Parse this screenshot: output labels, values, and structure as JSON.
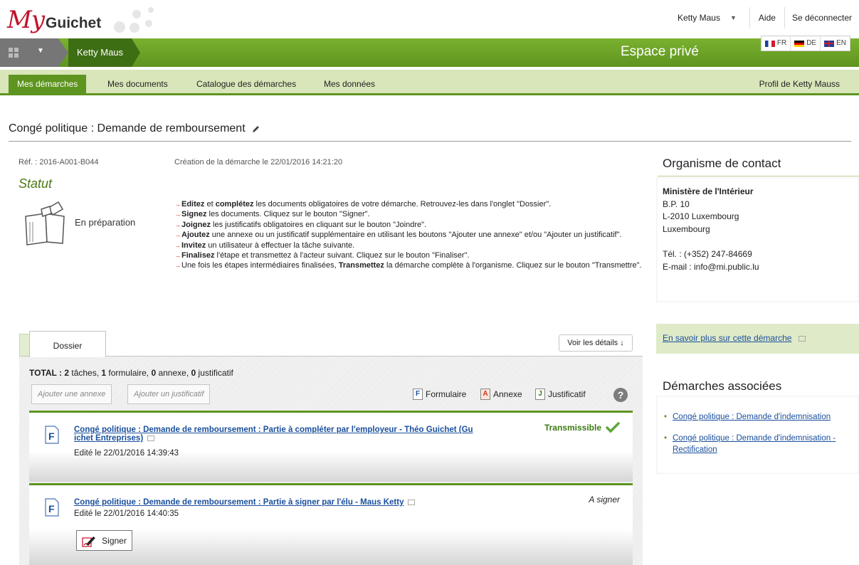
{
  "logo": {
    "my": "My",
    "guichet": "Guichet"
  },
  "user_menu": {
    "user_name": "Ketty Maus",
    "help": "Aide",
    "logout": "Se déconnecter"
  },
  "banner": {
    "user": "Ketty Maus",
    "title": "Espace privé"
  },
  "languages": [
    {
      "code": "FR",
      "flag": "fr"
    },
    {
      "code": "DE",
      "flag": "de"
    },
    {
      "code": "EN",
      "flag": "en"
    }
  ],
  "nav": {
    "items": [
      "Mes démarches",
      "Mes documents",
      "Catalogue des démarches",
      "Mes données"
    ],
    "active": "Mes démarches",
    "profile": "Profil de Ketty Mauss"
  },
  "page": {
    "title": "Congé politique : Demande de remboursement"
  },
  "info": {
    "ref": "Réf. : 2016-A001-B044",
    "created": "Création de la démarche le 22/01/2016 14:21:20",
    "statut_heading": "Statut",
    "status": "En préparation"
  },
  "instructions": [
    [
      {
        "b": "Editez"
      },
      {
        "t": " et "
      },
      {
        "b": "complétez"
      },
      {
        "t": " les documents obligatoires de votre démarche. Retrouvez-les dans l'onglet \"Dossier\"."
      }
    ],
    [
      {
        "b": "Signez"
      },
      {
        "t": " les documents. Cliquez sur le bouton \"Signer\"."
      }
    ],
    [
      {
        "b": "Joignez"
      },
      {
        "t": " les justificatifs obligatoires en cliquant sur le bouton \"Joindre\"."
      }
    ],
    [
      {
        "b": "Ajoutez"
      },
      {
        "t": " une annexe ou un justificatif supplémentaire en utilisant les boutons \"Ajouter une annexe\" et/ou \"Ajouter un justificatif\"."
      }
    ],
    [
      {
        "b": "Invitez"
      },
      {
        "t": " un utilisateur à effectuer la tâche suivante."
      }
    ],
    [
      {
        "b": "Finalisez"
      },
      {
        "t": " l'étape et transmettez à l'acteur suivant. Cliquez sur le bouton \"Finaliser\"."
      }
    ],
    [
      {
        "t": "Une fois les étapes intermédiaires finalisées, "
      },
      {
        "b": "Transmettez"
      },
      {
        "t": " la démarche complète à l'organisme. Cliquez sur le bouton \"Transmettre\"."
      }
    ]
  ],
  "dossier": {
    "tab": "Dossier",
    "details_button": "Voir les détails ↓",
    "total_label": "TOTAL :",
    "total": [
      {
        "n": "2",
        "label": " tâches, "
      },
      {
        "n": "1",
        "label": " formulaire, "
      },
      {
        "n": "0",
        "label": " annexe, "
      },
      {
        "n": "0",
        "label": " justificatif"
      }
    ],
    "add_annex": "Ajouter une annexe",
    "add_justif": "Ajouter un justificatif",
    "legend": {
      "form": "Formulaire",
      "annex": "Annexe",
      "justif": "Justificatif",
      "form_letter": "F",
      "annex_letter": "A",
      "justif_letter": "J"
    },
    "tasks": [
      {
        "title_line1": "Congé politique : Demande de remboursement : Partie à compléter par l'employeur - Théo Guichet (Gu",
        "title_line2": "ichet Entreprises)",
        "date": "Edité le 22/01/2016 14:39:43",
        "status": "Transmissible"
      },
      {
        "title_line1": "Congé politique : Demande de remboursement : Partie à signer par l'élu - Maus Ketty",
        "date": "Edité le 22/01/2016 14:40:35",
        "status": "A signer",
        "sign_button": "Signer"
      }
    ]
  },
  "sidebar": {
    "contact_heading": "Organisme de contact",
    "org_name": "Ministère de l'Intérieur",
    "bp": "B.P. 10",
    "city": "L-2010 Luxembourg",
    "country": "Luxembourg",
    "phone": "Tél. : (+352) 247-84669",
    "email": "E-mail : info@mi.public.lu",
    "more_info": "En savoir plus sur cette démarche",
    "assoc_heading": "Démarches associées",
    "assoc_items": [
      "Congé politique : Demande d'indemnisation",
      "Congé politique : Demande d'indemnisation - Rectification"
    ]
  },
  "colors": {
    "brand_green": "#5e9420",
    "logo_red": "#c0122c",
    "link_blue": "#1a4f9c",
    "status_green": "#3a7a12"
  },
  "icons": [
    "apps-grid-icon",
    "chevron-down-icon",
    "pencil-icon",
    "folder-open-icon",
    "help-icon",
    "check-icon",
    "popout-icon",
    "signature-icon",
    "form-icon",
    "annex-icon",
    "justif-icon"
  ]
}
